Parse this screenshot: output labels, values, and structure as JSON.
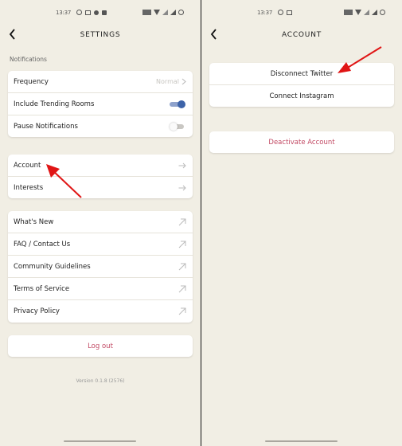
{
  "status_bar": {
    "time": "13:37",
    "left_screen_icons": [
      "whatsapp-icon",
      "laptop-icon",
      "app-icon",
      "image-icon"
    ],
    "right_screen_icons": [
      "whatsapp-icon",
      "laptop-icon"
    ],
    "system_icons": [
      "nfc-icon",
      "wifi-icon",
      "signal-icon",
      "signal-icon",
      "battery-icon"
    ]
  },
  "settings_screen": {
    "title": "SETTINGS",
    "notifications_label": "Notifications",
    "notifications": [
      {
        "label": "Frequency",
        "value": "Normal",
        "type": "select"
      },
      {
        "label": "Include Trending Rooms",
        "type": "toggle",
        "on": true
      },
      {
        "label": "Pause Notifications",
        "type": "toggle",
        "on": false
      }
    ],
    "account_items": [
      {
        "label": "Account",
        "icon": "arrow-right-icon"
      },
      {
        "label": "Interests",
        "icon": "arrow-right-icon"
      }
    ],
    "link_items": [
      {
        "label": "What's New",
        "icon": "external-link-icon"
      },
      {
        "label": "FAQ / Contact Us",
        "icon": "external-link-icon"
      },
      {
        "label": "Community Guidelines",
        "icon": "external-link-icon"
      },
      {
        "label": "Terms of Service",
        "icon": "external-link-icon"
      },
      {
        "label": "Privacy Policy",
        "icon": "external-link-icon"
      }
    ],
    "logout_label": "Log out",
    "version": "Version 0.1.8 (2576)"
  },
  "account_screen": {
    "title": "ACCOUNT",
    "social_items": [
      {
        "label": "Disconnect Twitter"
      },
      {
        "label": "Connect Instagram"
      }
    ],
    "deactivate_label": "Deactivate Account"
  },
  "colors": {
    "background": "#f1eee4",
    "accent_red": "#c24a64",
    "toggle_on": "#3d63a8",
    "annotation_arrow": "#e01515"
  }
}
